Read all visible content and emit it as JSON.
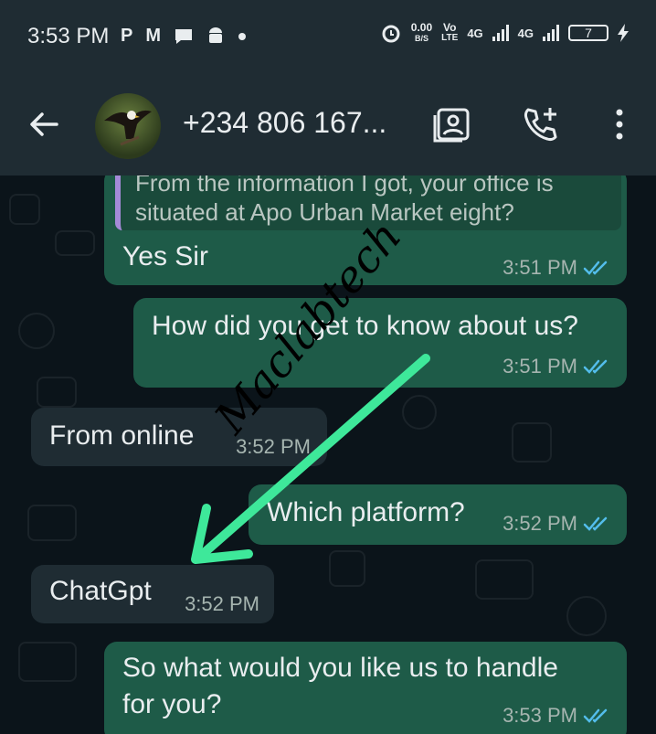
{
  "status_bar": {
    "time": "3:53 PM",
    "net_speed_value": "0.00",
    "net_speed_unit": "B/S",
    "volte_top": "Vo",
    "volte_bottom": "LTE",
    "signal1_label": "4G",
    "signal2_label": "4G",
    "battery": "7",
    "left_icons": [
      "P",
      "M"
    ]
  },
  "header": {
    "contact_name": "+234 806 167..."
  },
  "messages": [
    {
      "direction": "outgoing",
      "quote_text": "From the information I got, your office is situated at Apo Urban Market eight?",
      "text": "Yes Sir",
      "time": "3:51 PM",
      "status": "read"
    },
    {
      "direction": "outgoing",
      "text": "How did you get to know about us?",
      "time": "3:51 PM",
      "status": "read"
    },
    {
      "direction": "incoming",
      "text": "From online",
      "time": "3:52 PM"
    },
    {
      "direction": "outgoing",
      "text": "Which platform?",
      "time": "3:52 PM",
      "status": "read"
    },
    {
      "direction": "incoming",
      "text": "ChatGpt",
      "time": "3:52 PM"
    },
    {
      "direction": "outgoing",
      "text_line1": "So what would you like us to handle",
      "text_line2": "for you?",
      "time": "3:53 PM",
      "status": "read"
    }
  ],
  "annotation": {
    "watermark": "Maclabtech",
    "arrow_color": "#3ee89a"
  },
  "colors": {
    "outgoing_bubble": "#1e5b48",
    "incoming_bubble": "#1f2c33",
    "read_ticks": "#53bdeb",
    "header": "#1f2c33"
  }
}
